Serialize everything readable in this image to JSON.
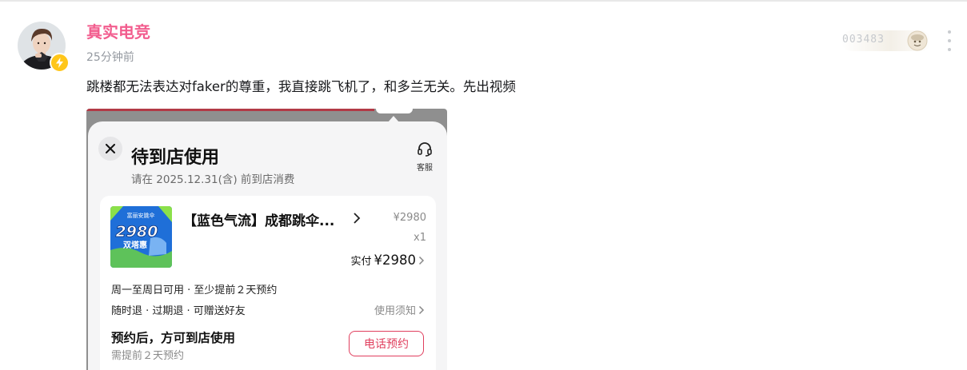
{
  "post": {
    "username": "真实电竞",
    "timestamp": "25分钟前",
    "text": "跳楼都无法表达对faker的尊重，我直接跳飞机了，和多兰无关。先出视频",
    "fan_badge_number": "003483",
    "more_icon": "more-vertical-icon",
    "badge_icon": "lightning-icon",
    "colors": {
      "username": "#f25d8e",
      "badge": "#ffc61a"
    }
  },
  "screenshot": {
    "title": "待到店使用",
    "subtitle": "请在 2025.12.31(含) 前到店消费",
    "service_label": "客服",
    "service_icon": "headset-icon",
    "close_icon": "close-icon",
    "product": {
      "title": "【蓝色气流】成都跳伞...",
      "thumb_top": "富丽安跳伞",
      "thumb_price": "2980",
      "thumb_label": "双塔惠",
      "price": "¥2980",
      "quantity": "x1",
      "paid_label": "实付",
      "paid_amount": "¥2980"
    },
    "rules": {
      "line1": "周一至周日可用 · 至少提前２天预约",
      "line2": "随时退 · 过期退 · 可赠送好友",
      "notice": "使用须知"
    },
    "booking": {
      "title": "预约后，方可到店使用",
      "subtitle": "需提前２天预约",
      "button": "电话预约"
    },
    "colors": {
      "accent": "#e03f5e"
    }
  }
}
